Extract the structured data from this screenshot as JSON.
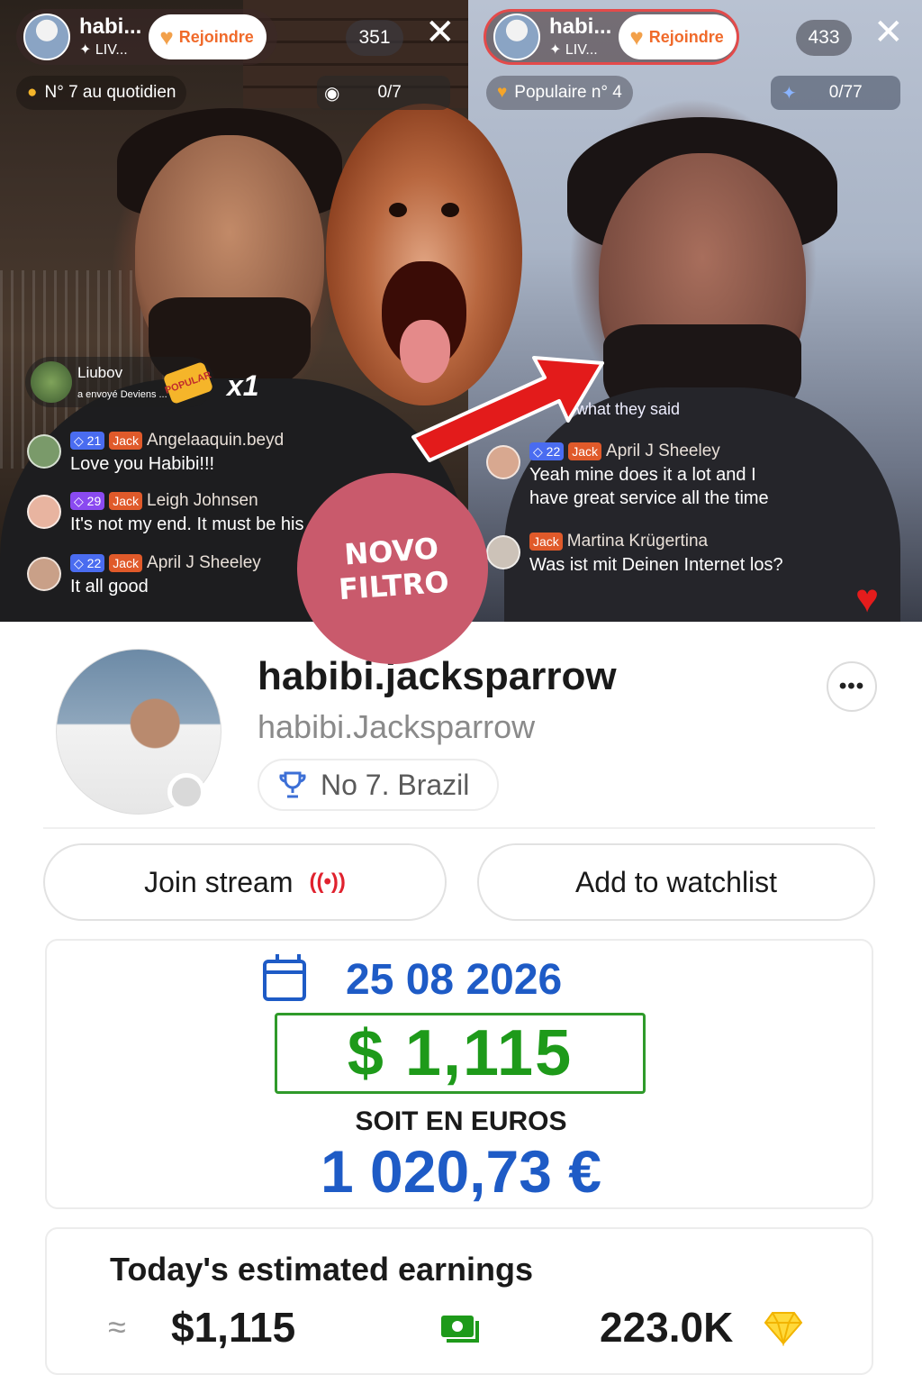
{
  "left_stream": {
    "host_name": "habi...",
    "host_sub": "✦ LIV...",
    "join_label": "Rejoindre",
    "viewer_count": "351",
    "rank_label": "N° 7 au quotidien",
    "goal_label": "0/7",
    "gift": {
      "sender": "Liubov",
      "text": "a envoyé Deviens ...",
      "sticker": "POPULAR",
      "multiplier": "x1"
    },
    "chat": [
      {
        "level": "21",
        "tag": "Jack",
        "user": "Angelaaquin.beyd",
        "message": "Love you Habibi!!!"
      },
      {
        "level": "29",
        "tag": "Jack",
        "user": "Leigh Johnsen",
        "message": "It's not my end. It must be his"
      },
      {
        "level": "22",
        "tag": "Jack",
        "user": "April J Sheeley",
        "message": "It all good"
      }
    ]
  },
  "right_stream": {
    "host_name": "habi...",
    "host_sub": "✦ LIV...",
    "join_label": "Rejoindre",
    "viewer_count": "433",
    "rank_label": "Populaire n° 4",
    "goal_label": "0/77",
    "partial_comment": "what they said",
    "chat": [
      {
        "level": "22",
        "tag": "Jack",
        "user": "April J Sheeley",
        "message": "Yeah mine does it a lot and I have great service all the time"
      },
      {
        "tag": "Jack",
        "user": "Martina Krügertina",
        "message": "Was ist mit Deinen Internet los?"
      }
    ]
  },
  "overlay": {
    "line1": "NOVO",
    "line2": "FILTRO"
  },
  "profile": {
    "display_name": "habibi.jacksparrow",
    "handle": "habibi.Jacksparrow",
    "rank": "No 7. Brazil"
  },
  "actions": {
    "join_stream": "Join stream",
    "watchlist": "Add to watchlist"
  },
  "amount_card": {
    "date": "25 08 2026",
    "usd": "$  1,115",
    "caption": "SOIT EN EUROS",
    "eur": "1 020,73 €"
  },
  "earnings": {
    "title": "Today's estimated earnings",
    "approx_symbol": "≈",
    "usd": "$1,115",
    "diamonds": "223.0K"
  },
  "colors": {
    "accent_blue": "#1e5bc6",
    "money_green": "#1e9a1a",
    "live_red": "#e0222e",
    "join_orange": "#f06a2a"
  },
  "icons": [
    "close-icon",
    "calendar-icon",
    "trophy-icon",
    "live-broadcast-icon",
    "cash-icon",
    "diamond-icon",
    "heart-icon",
    "more-icon"
  ]
}
